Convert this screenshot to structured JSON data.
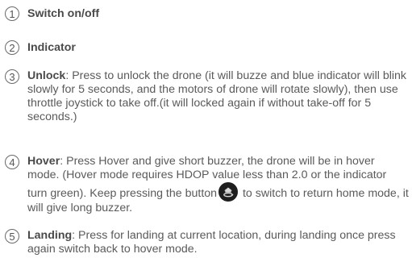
{
  "items": [
    {
      "num": "1",
      "title": "Switch on/off"
    },
    {
      "num": "2",
      "title": "Indicator"
    },
    {
      "num": "3",
      "title": "Unlock",
      "body": ": Press to unlock the drone (it will buzze and blue indicator will blink slowly for 5 seconds, and the motors of drone will rotate slowly), then use throttle joystick to take off.(it will locked again if without take-off for 5 seconds.)"
    },
    {
      "num": "4",
      "title": "Hover",
      "body_before_icon": ": Press Hover and give short buzzer, the drone will be in hover mode. (Hover mode requires HDOP value less than 2.0 or the indicator turn green). Keep pressing the button",
      "body_after_icon": " to switch to return home mode, it will give long buzzer.",
      "icon": "return-home-icon"
    },
    {
      "num": "5",
      "title": "Landing",
      "body": ": Press for landing at current location, during landing once press again switch back to hover mode."
    }
  ]
}
